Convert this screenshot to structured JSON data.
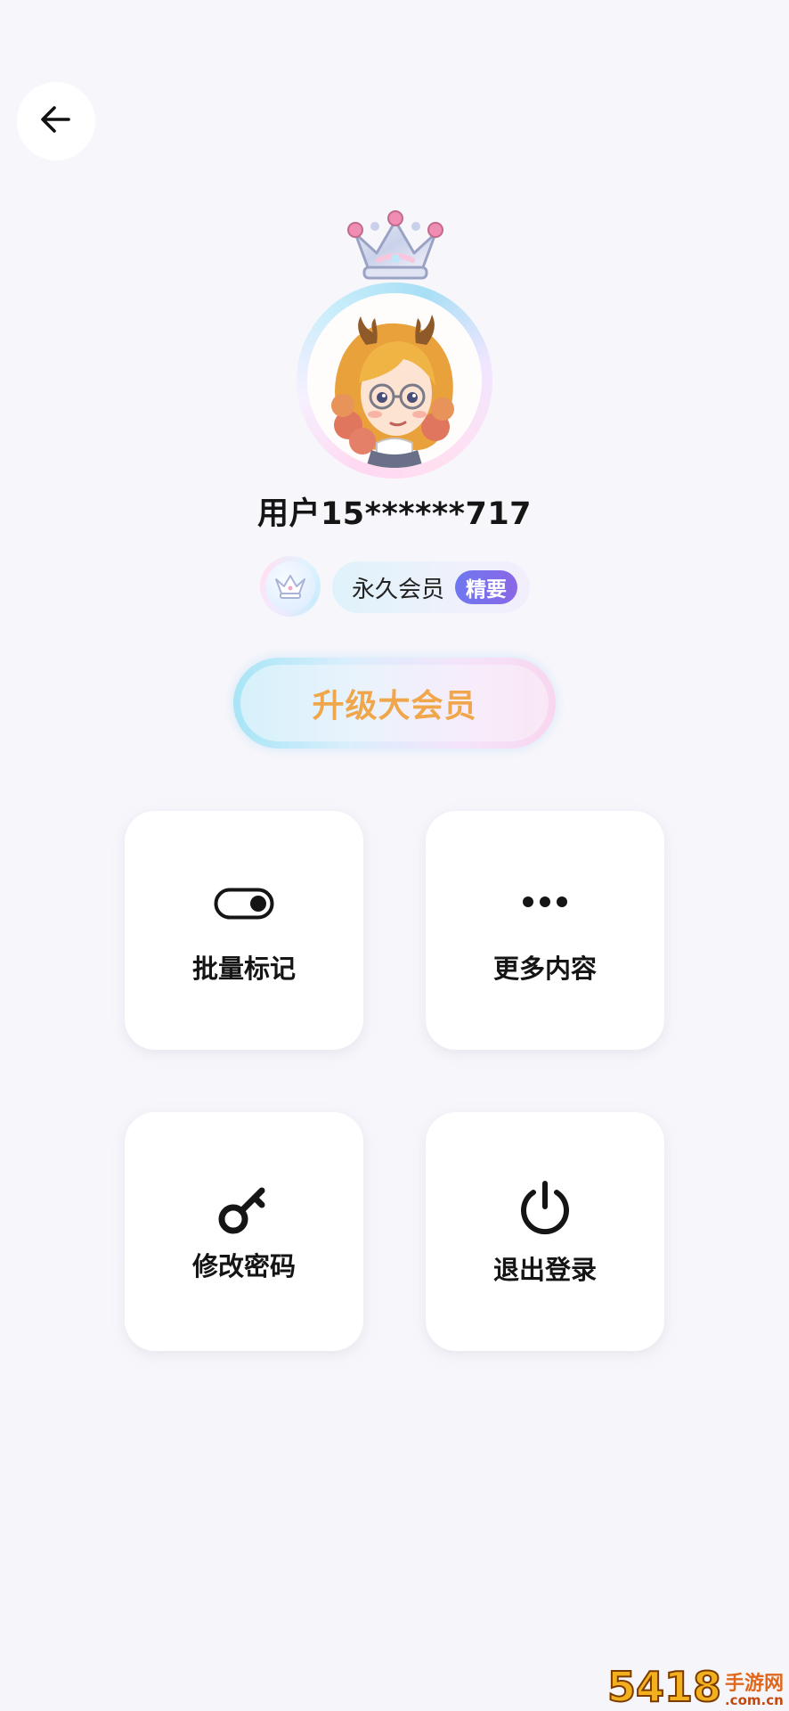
{
  "header": {
    "back_icon": "arrow-left-icon"
  },
  "profile": {
    "crown_icon": "crown-icon",
    "avatar": "cartoon-avatar",
    "username": "用户15******717"
  },
  "membership": {
    "badge_icon": "crown-badge-icon",
    "label": "永久会员",
    "tag": "精要"
  },
  "upgrade": {
    "label": "升级大会员",
    "text_color": "#f0a64a"
  },
  "actions": [
    {
      "icon": "toggle-icon",
      "label": "批量标记"
    },
    {
      "icon": "more-dots-icon",
      "label": "更多内容"
    },
    {
      "icon": "key-icon",
      "label": "修改密码"
    },
    {
      "icon": "power-icon",
      "label": "退出登录"
    }
  ],
  "watermark": {
    "number": "5418",
    "site": "手游网",
    "domain": ".com.cn"
  }
}
